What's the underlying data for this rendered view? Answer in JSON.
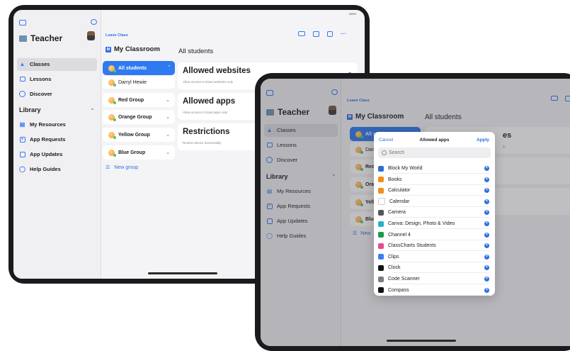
{
  "tablet_front": {
    "status_time": "9:41",
    "status_battery": "100%",
    "sidebar": {
      "title": "Teacher",
      "items": [
        {
          "label": "Classes",
          "icon": "graduation-cap-icon"
        },
        {
          "label": "Lessons",
          "icon": "folder-icon"
        },
        {
          "label": "Discover",
          "icon": "compass-icon"
        }
      ],
      "library_heading": "Library",
      "library_items": [
        {
          "label": "My Resources",
          "icon": "books-icon"
        },
        {
          "label": "App Requests",
          "icon": "plus-square-icon"
        },
        {
          "label": "App Updates",
          "icon": "download-box-icon"
        },
        {
          "label": "Help Guides",
          "icon": "lightbulb-icon"
        }
      ]
    },
    "toolbar": {
      "leave_class": "Leave Class"
    },
    "class_title": "My Classroom",
    "class_badge": "M",
    "groups": [
      {
        "label": "All students",
        "selected": true
      },
      {
        "label": "Darryl Hewie",
        "selected": false
      },
      {
        "label": "Red Group",
        "selected": false
      },
      {
        "label": "Orange Group",
        "selected": false
      },
      {
        "label": "Yellow Group",
        "selected": false
      },
      {
        "label": "Blue Group",
        "selected": false
      }
    ],
    "new_group": "New group",
    "detail_heading": "All students",
    "cards": [
      {
        "title": "Allowed websites",
        "subtitle": "Allow access to listed websites only"
      },
      {
        "title": "Allowed apps",
        "subtitle": "Allow access to listed apps only"
      },
      {
        "title": "Restrictions",
        "subtitle": "Restrict device functionality"
      }
    ]
  },
  "tablet_back": {
    "status_time": "9:41",
    "sidebar": {
      "title": "Teacher",
      "items": [
        "Classes",
        "Lessons",
        "Discover"
      ],
      "library_heading": "Library",
      "library_items": [
        "My Resources",
        "App Requests",
        "App Updates",
        "Help Guides"
      ]
    },
    "toolbar": {
      "leave_class": "Leave Class"
    },
    "class_title": "My Classroom",
    "class_badge": "M",
    "detail_heading": "All students",
    "group_fragments": [
      "All students",
      "Darr",
      "Red",
      "Oran",
      "Yello",
      "Blue",
      "New"
    ],
    "card_fragments": [
      "es",
      "ly"
    ],
    "modal": {
      "cancel": "Cancel",
      "title": "Allowed apps",
      "apply": "Apply",
      "search_placeholder": "Search",
      "apps": [
        {
          "name": "Block My World",
          "color": "#2e6fd1",
          "icon": "globe-icon"
        },
        {
          "name": "Books",
          "color": "#f28c1e",
          "icon": "book-icon"
        },
        {
          "name": "Calculator",
          "color": "#f28c1e",
          "icon": "calculator-icon"
        },
        {
          "name": "Calendar",
          "color": "#ffffff",
          "icon": "calendar-icon"
        },
        {
          "name": "Camera",
          "color": "#555555",
          "icon": "camera-icon"
        },
        {
          "name": "Canva: Design, Photo & Video",
          "color": "#2ab0c9",
          "icon": "canva-icon"
        },
        {
          "name": "Channel 4",
          "color": "#1d9a4a",
          "icon": "channel4-icon"
        },
        {
          "name": "ClassCharts Students",
          "color": "#e84b8a",
          "icon": "classcharts-icon"
        },
        {
          "name": "Clips",
          "color": "#3a7cf5",
          "icon": "clips-icon"
        },
        {
          "name": "Clock",
          "color": "#111111",
          "icon": "clock-icon"
        },
        {
          "name": "Code Scanner",
          "color": "#7b7b80",
          "icon": "qr-icon"
        },
        {
          "name": "Compass",
          "color": "#111111",
          "icon": "compass-icon"
        }
      ]
    }
  }
}
